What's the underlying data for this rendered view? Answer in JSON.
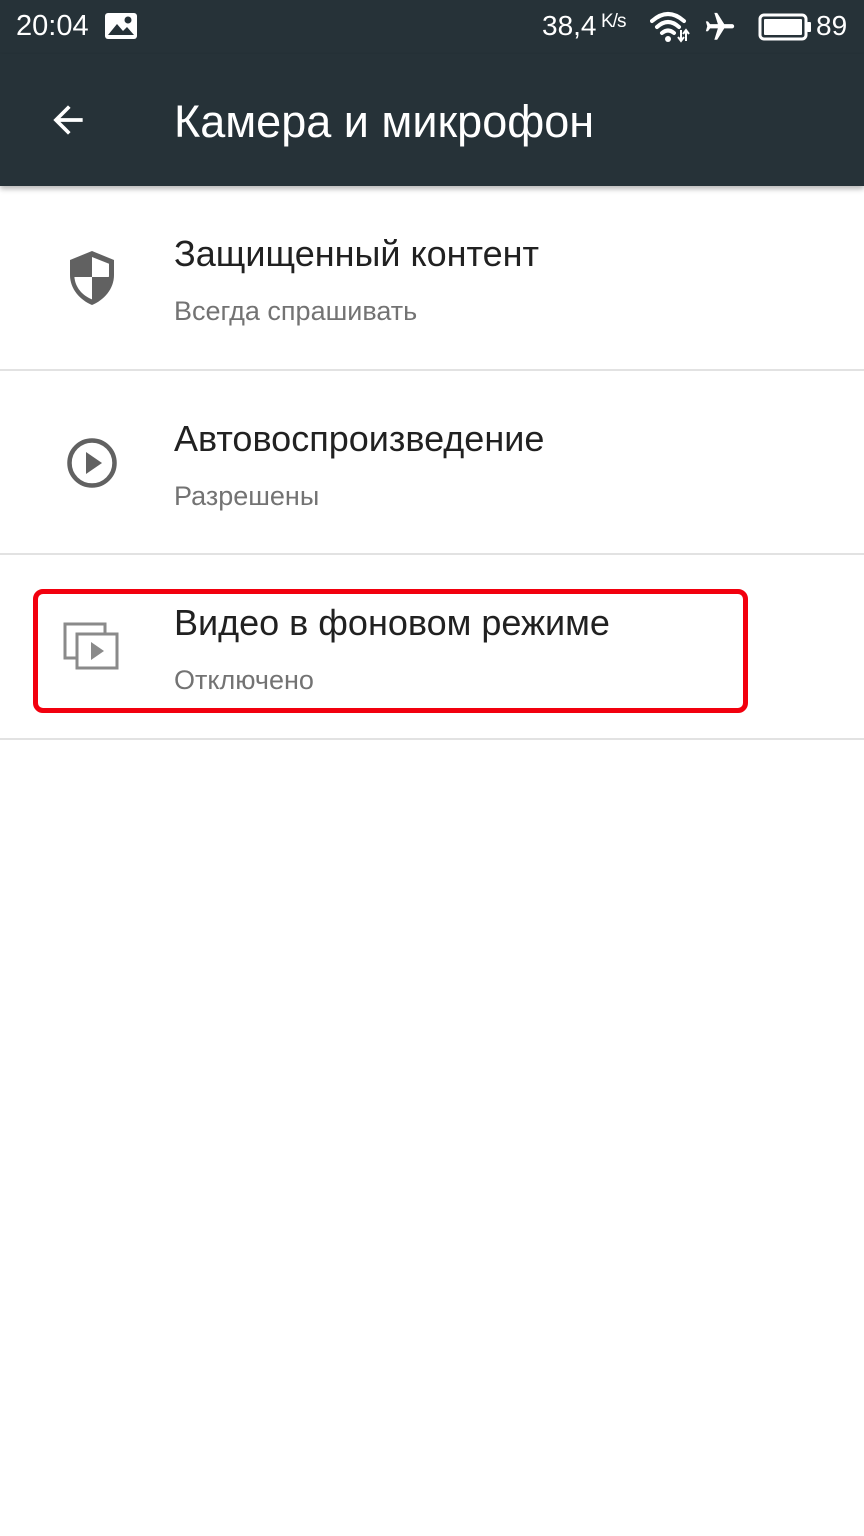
{
  "status_bar": {
    "time": "20:04",
    "network_speed": "38,4",
    "network_speed_unit": "K/s",
    "battery_level": "89",
    "icons": [
      "photo-notification-icon",
      "wifi-icon",
      "airplane-mode-icon",
      "battery-icon"
    ]
  },
  "toolbar": {
    "title": "Камера и микрофон",
    "back_icon": "arrow-back-icon"
  },
  "settings": [
    {
      "icon": "shield-icon",
      "title": "Защищенный контент",
      "summary": "Всегда спрашивать"
    },
    {
      "icon": "play-circle-icon",
      "title": "Автовоспроизведение",
      "summary": "Разрешены"
    },
    {
      "icon": "picture-in-picture-icon",
      "title": "Видео в фоновом режиме",
      "summary": "Отключено",
      "highlighted": true
    }
  ],
  "colors": {
    "toolbar_bg": "#263238",
    "title_text": "#212121",
    "summary_text": "#737373",
    "icon": "#616161",
    "highlight": "#f2000e",
    "divider": "#e2e2e2"
  }
}
